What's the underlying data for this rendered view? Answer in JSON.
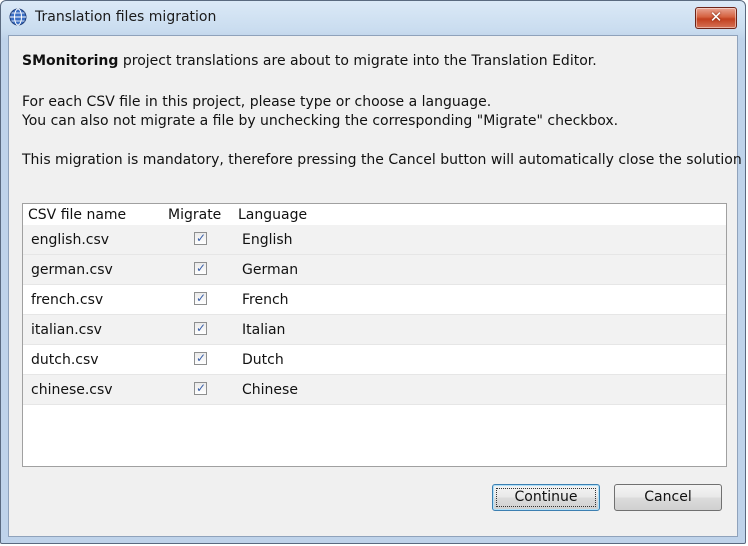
{
  "window": {
    "title": "Translation files migration",
    "close_symbol": "✕",
    "icon": "globe-icon"
  },
  "message": {
    "project_name": "SMonitoring",
    "line1_rest": " project translations are about to migrate into the Translation Editor.",
    "line2": "For each CSV file in this project, please type or choose a language.",
    "line3": "You can also not migrate a file by unchecking the corresponding \"Migrate\" checkbox.",
    "line4": "This migration is mandatory, therefore pressing the Cancel button will automatically close the solution"
  },
  "table": {
    "columns": [
      "CSV file name",
      "Migrate",
      "Language"
    ],
    "rows": [
      {
        "file": "english.csv",
        "migrate": true,
        "language": "English"
      },
      {
        "file": "german.csv",
        "migrate": true,
        "language": "German"
      },
      {
        "file": "french.csv",
        "migrate": true,
        "language": "French"
      },
      {
        "file": "italian.csv",
        "migrate": true,
        "language": "Italian"
      },
      {
        "file": "dutch.csv",
        "migrate": true,
        "language": "Dutch"
      },
      {
        "file": "chinese.csv",
        "migrate": true,
        "language": "Chinese"
      }
    ],
    "check_mark": "✓"
  },
  "buttons": {
    "continue_label": "Continue",
    "cancel_label": "Cancel"
  },
  "colors": {
    "titlebar": "#c9dcef",
    "close_button": "#c2401f",
    "dialog_background": "#f0f0f0",
    "row_alt": "#f2f2f2",
    "checkmark": "#3a5fa8"
  }
}
